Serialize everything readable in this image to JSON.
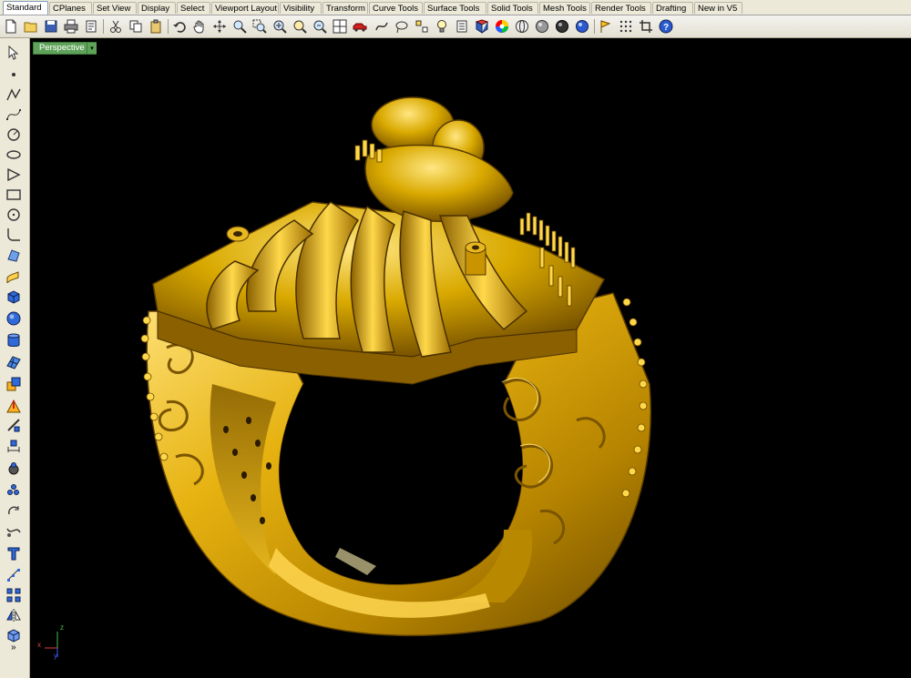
{
  "tabs": [
    {
      "label": "Standard",
      "active": true
    },
    {
      "label": "CPlanes"
    },
    {
      "label": "Set View"
    },
    {
      "label": "Display"
    },
    {
      "label": "Select"
    },
    {
      "label": "Viewport Layout"
    },
    {
      "label": "Visibility"
    },
    {
      "label": "Transform"
    },
    {
      "label": "Curve Tools"
    },
    {
      "label": "Surface Tools"
    },
    {
      "label": "Solid Tools"
    },
    {
      "label": "Mesh Tools"
    },
    {
      "label": "Render Tools"
    },
    {
      "label": "Drafting"
    },
    {
      "label": "New in V5"
    }
  ],
  "viewport": {
    "title": "Perspective",
    "dropdown_glyph": "▾",
    "background": "#000000",
    "axis": {
      "x": "x",
      "y": "y",
      "z": "z"
    }
  },
  "left_toolbar": {
    "more_glyph": "»"
  },
  "colors": {
    "gold": "#d9a900",
    "gold_highlight": "#ffe070",
    "gold_shadow": "#6b4a00",
    "viewport_tab": "#5fa35a"
  }
}
